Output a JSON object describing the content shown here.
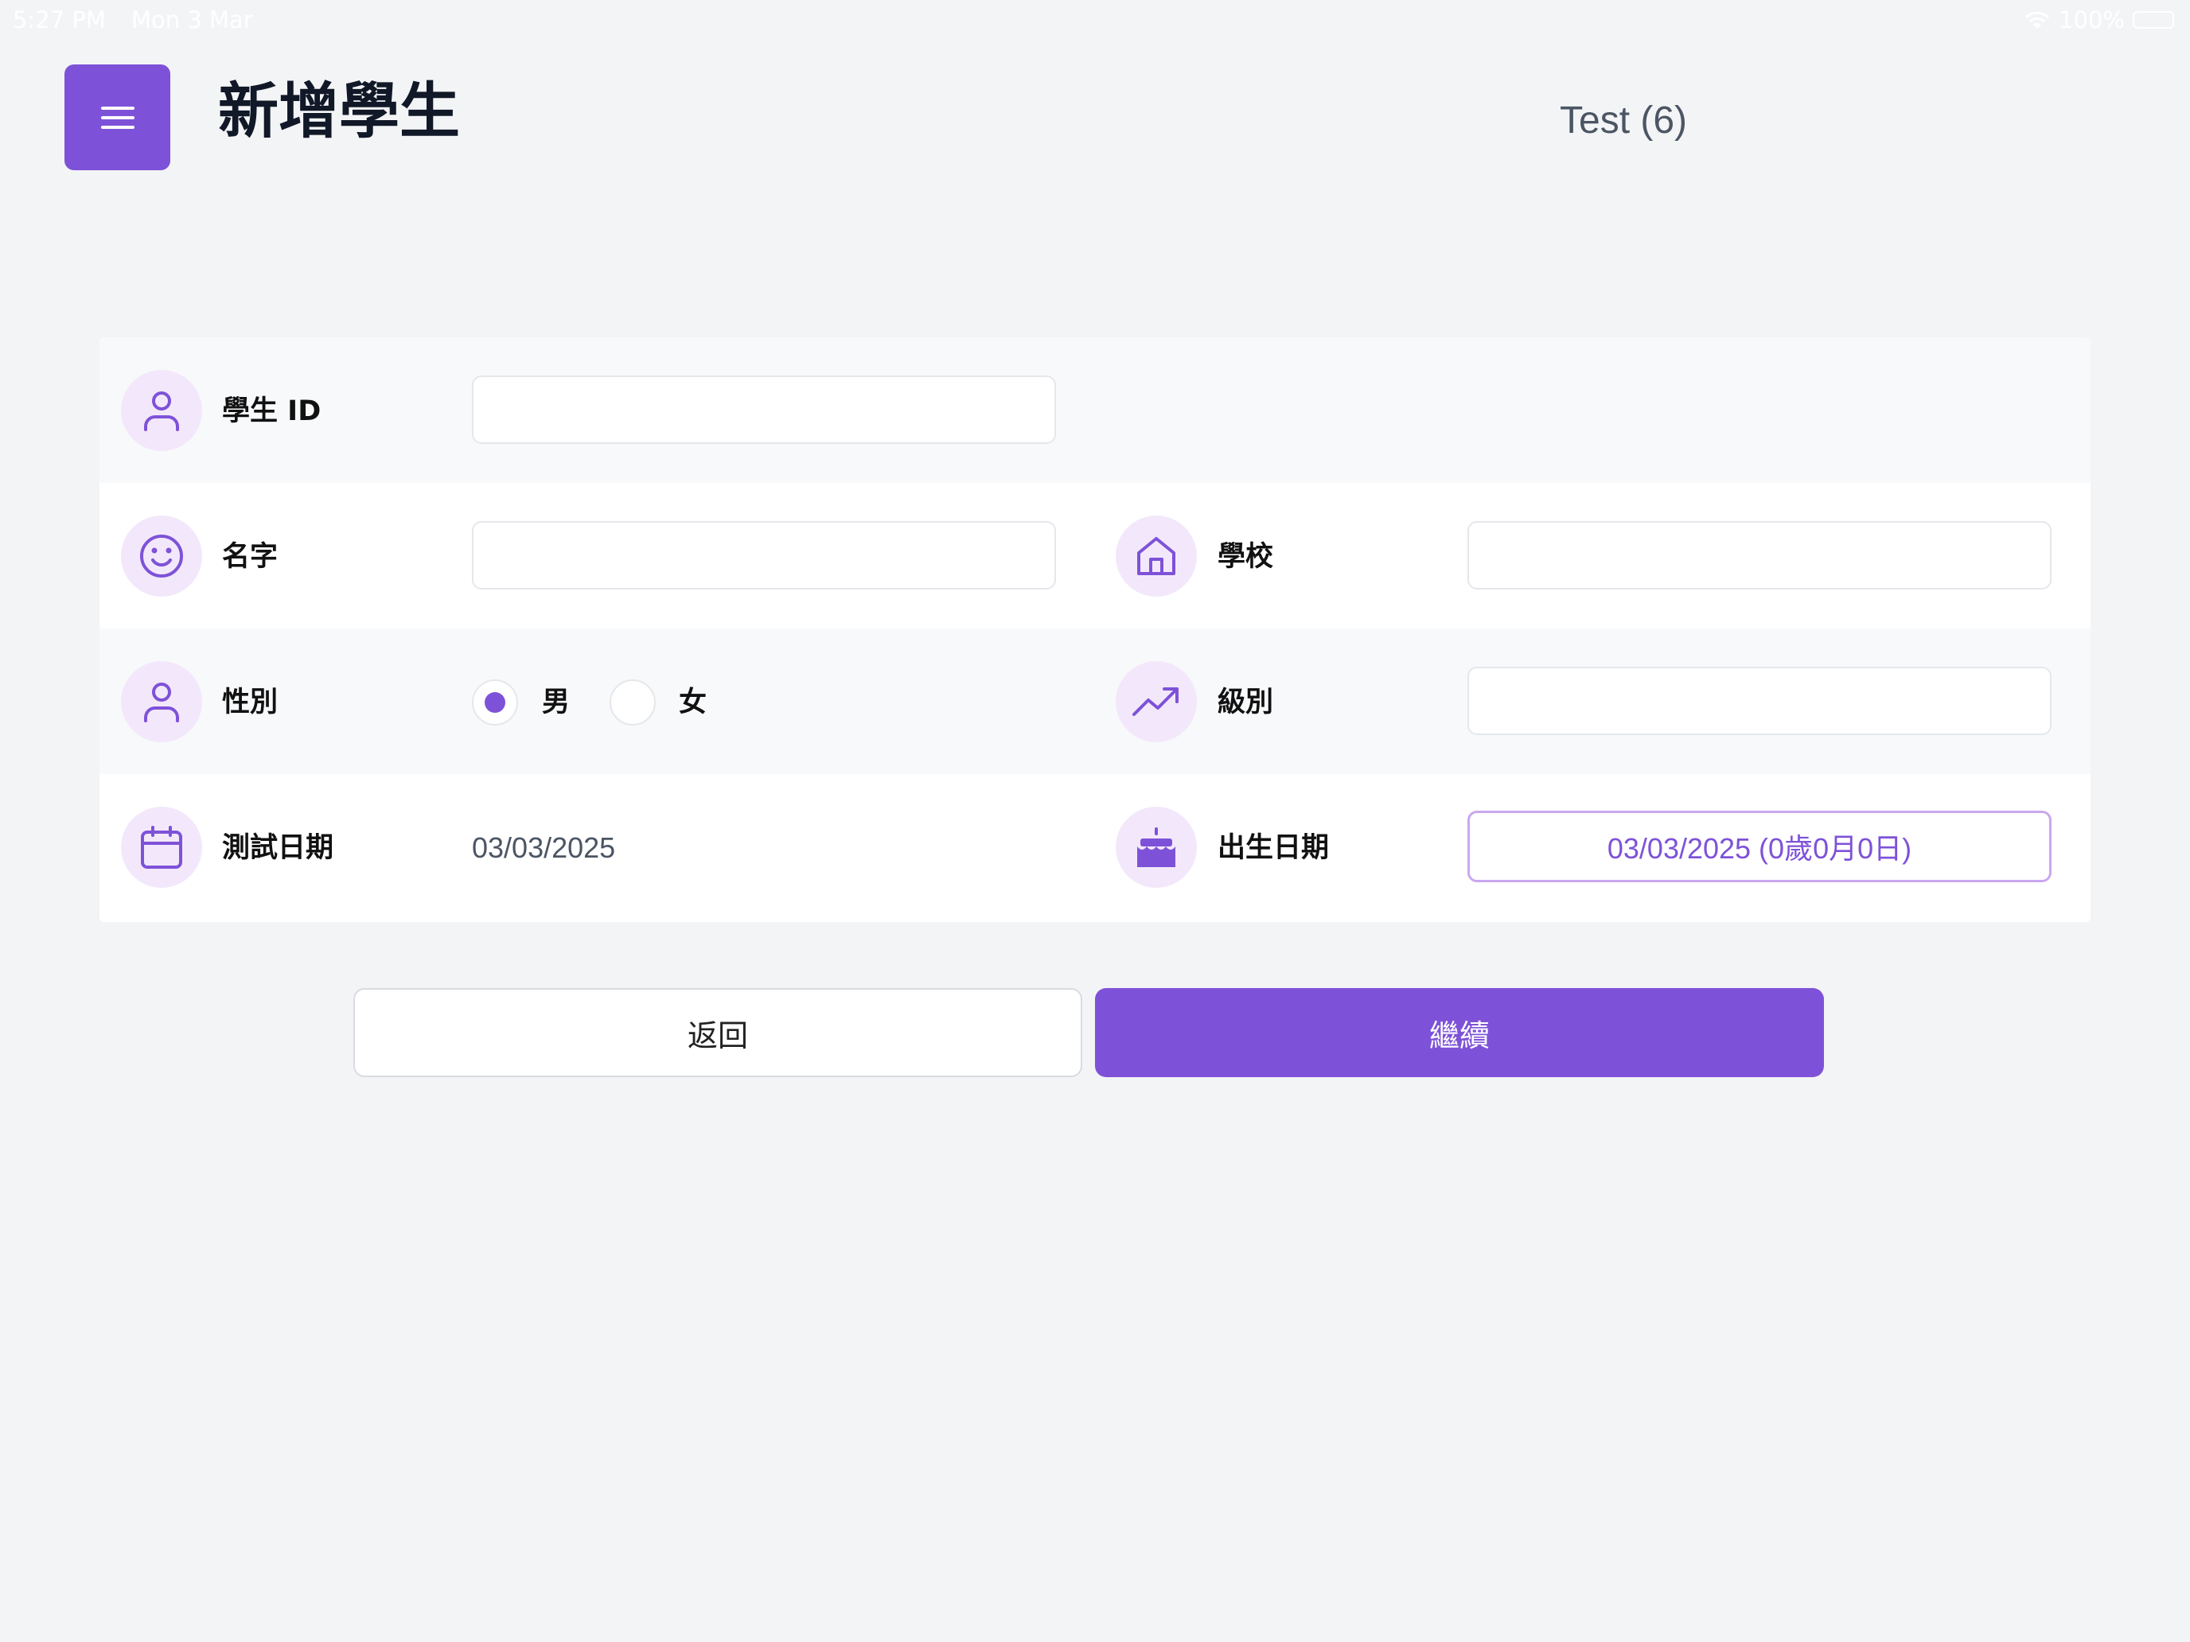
{
  "status_bar": {
    "time": "5:27 PM",
    "date": "Mon 3 Mar",
    "battery": "100%"
  },
  "header": {
    "menu_icon": "hamburger-menu-icon",
    "title": "新增學生",
    "test_label": "Test (6)"
  },
  "form": {
    "student_id": {
      "label": "學生 ID",
      "value": "",
      "icon": "user-icon"
    },
    "name": {
      "label": "名字",
      "value": "",
      "icon": "smile-icon"
    },
    "school": {
      "label": "學校",
      "value": "",
      "icon": "home-icon"
    },
    "gender": {
      "label": "性別",
      "icon": "user-icon",
      "options": [
        "男",
        "女"
      ],
      "selected": "男"
    },
    "grade": {
      "label": "級別",
      "value": "",
      "icon": "trending-up-icon"
    },
    "test_date": {
      "label": "測試日期",
      "value": "03/03/2025",
      "icon": "calendar-icon"
    },
    "birth_date": {
      "label": "出生日期",
      "value": "03/03/2025 (0歲0月0日)",
      "icon": "cake-icon"
    }
  },
  "actions": {
    "back_label": "返回",
    "continue_label": "繼續"
  },
  "colors": {
    "accent": "#7e52d8",
    "icon_bg": "#f3e8fb",
    "background": "#f3f4f6"
  }
}
